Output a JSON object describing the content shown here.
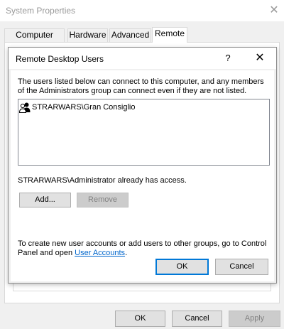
{
  "outer_window": {
    "title": "System Properties",
    "close_glyph": "✕",
    "tabs": [
      {
        "label": "Computer Name",
        "active": false
      },
      {
        "label": "Hardware",
        "active": false
      },
      {
        "label": "Advanced",
        "active": false
      },
      {
        "label": "Remote",
        "active": true
      }
    ],
    "buttons": {
      "ok": "OK",
      "cancel": "Cancel",
      "apply": "Apply"
    }
  },
  "dialog": {
    "title": "Remote Desktop Users",
    "help_glyph": "?",
    "close_glyph": "✕",
    "description": "The users listed below can connect to this computer, and any members of the Administrators group can connect even if they are not listed.",
    "users": [
      {
        "name": "STRARWARS\\Gran Consiglio",
        "icon": "users-group-icon"
      }
    ],
    "access_text": "STRARWARS\\Administrator already has access.",
    "add_button": "Add...",
    "remove_button": "Remove",
    "hint_prefix": "To create new user accounts or add users to other groups, go to Control Panel and open ",
    "hint_link": "User Accounts",
    "hint_suffix": ".",
    "ok_button": "OK",
    "cancel_button": "Cancel"
  },
  "colors": {
    "link": "#0066cc",
    "focus": "#0078d7",
    "window_bg": "#f0f0f0"
  }
}
